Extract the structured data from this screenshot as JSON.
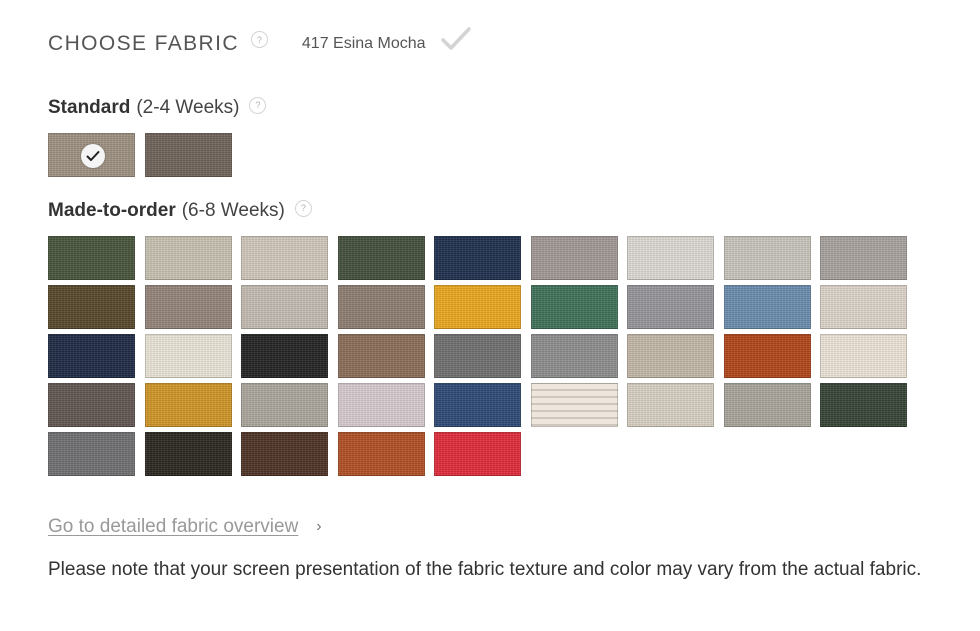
{
  "header": {
    "title": "CHOOSE FABRIC",
    "help_glyph": "?",
    "selected_fabric": "417 Esina Mocha",
    "check_icon": "checkmark-icon"
  },
  "standard": {
    "title": "Standard",
    "subtitle": "(2-4 Weeks)",
    "swatches": [
      {
        "color": "#9e9182",
        "selected": true
      },
      {
        "color": "#6f635a",
        "selected": false
      }
    ]
  },
  "made_to_order": {
    "title": "Made-to-order",
    "subtitle": "(6-8 Weeks)",
    "swatches": [
      {
        "color": "#47543a"
      },
      {
        "color": "#c6c1b1"
      },
      {
        "color": "#d0c7ba"
      },
      {
        "color": "#454f3b"
      },
      {
        "color": "#1f2f4d"
      },
      {
        "color": "#a19895"
      },
      {
        "color": "#dcd9d2"
      },
      {
        "color": "#c8c4bc"
      },
      {
        "color": "#a8a29d"
      },
      {
        "color": "#56482b"
      },
      {
        "color": "#94837a"
      },
      {
        "color": "#c3bbb2"
      },
      {
        "color": "#8c7d71"
      },
      {
        "color": "#eaa71f"
      },
      {
        "color": "#3f7158"
      },
      {
        "color": "#95959a"
      },
      {
        "color": "#6a8cae"
      },
      {
        "color": "#dcd3ca"
      },
      {
        "color": "#1e2b45"
      },
      {
        "color": "#e9e4d7"
      },
      {
        "color": "#232323"
      },
      {
        "color": "#8a6d57"
      },
      {
        "color": "#6f6f6f"
      },
      {
        "color": "#8d8d8e"
      },
      {
        "color": "#c2b7a8"
      },
      {
        "color": "#b0461a"
      },
      {
        "color": "#ece3d6"
      },
      {
        "color": "#615551"
      },
      {
        "color": "#cf9526"
      },
      {
        "color": "#aba69d"
      },
      {
        "color": "#d6cbce"
      },
      {
        "color": "#2e4a76"
      },
      {
        "color": "#ede5da",
        "striped": true
      },
      {
        "color": "#d7cfc2"
      },
      {
        "color": "#a9a49b"
      },
      {
        "color": "#364536"
      },
      {
        "color": "#6f6e71"
      },
      {
        "color": "#2b2620"
      },
      {
        "color": "#4d3325"
      },
      {
        "color": "#b04f24"
      },
      {
        "color": "#e02b3a"
      }
    ]
  },
  "overview_link": "Go to detailed fabric overview",
  "chevron_glyph": "›",
  "note": "Please note that your screen presentation of the fabric texture and color may vary from the actual fabric."
}
